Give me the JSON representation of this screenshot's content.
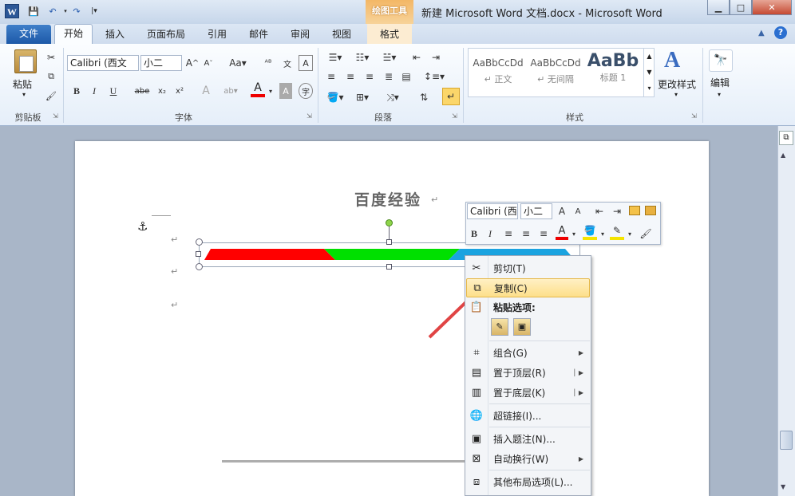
{
  "window": {
    "title": "新建 Microsoft Word 文档.docx - Microsoft Word",
    "contextual_tab_title": "绘图工具",
    "app_icon_letter": "W"
  },
  "tabs": {
    "file": "文件",
    "items": [
      "开始",
      "插入",
      "页面布局",
      "引用",
      "邮件",
      "审阅",
      "视图"
    ],
    "format": "格式"
  },
  "ribbon": {
    "clipboard": {
      "paste": "粘贴",
      "group": "剪贴板"
    },
    "font": {
      "family": "Calibri (西文",
      "size": "小二",
      "group": "字体",
      "buttons": [
        "B",
        "I",
        "U",
        "abe",
        "x₂",
        "x²"
      ]
    },
    "paragraph": {
      "group": "段落"
    },
    "styles": {
      "group": "样式",
      "items": [
        {
          "preview": "AaBbCcDd",
          "name": "↵ 正文"
        },
        {
          "preview": "AaBbCcDd",
          "name": "↵ 无间隔"
        },
        {
          "preview": "AaBb",
          "name": "标题 1"
        }
      ],
      "change_styles": "更改样式",
      "edit": "编辑"
    }
  },
  "document": {
    "title": "百度经验",
    "shape_colors": [
      "#ff0000",
      "#00e000",
      "#1aa3e0"
    ]
  },
  "mini_toolbar": {
    "font": "Calibri (西",
    "size": "小二"
  },
  "context_menu": {
    "cut": "剪切(T)",
    "copy": "复制(C)",
    "paste_options": "粘贴选项:",
    "group": "组合(G)",
    "bring_front": "置于顶层(R)",
    "send_back": "置于底层(K)",
    "hyperlink": "超链接(I)...",
    "insert_caption": "插入题注(N)...",
    "wrap_text": "自动换行(W)",
    "more_layout": "其他布局选项(L)..."
  }
}
